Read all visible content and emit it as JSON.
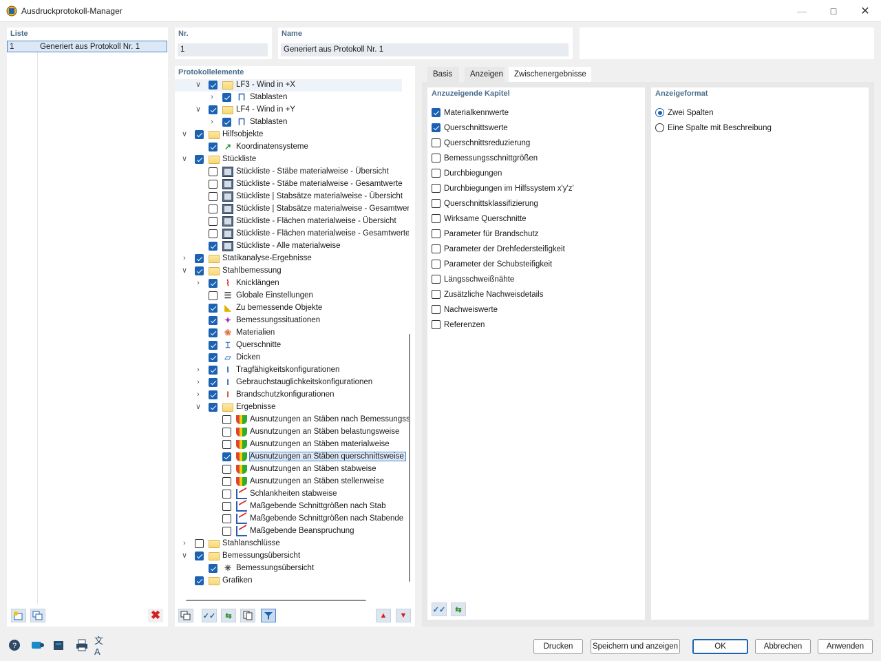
{
  "window": {
    "title": "Ausdruckprotokoll-Manager"
  },
  "list": {
    "label": "Liste",
    "rows": [
      {
        "num": "1",
        "name": "Generiert aus Protokoll Nr. 1"
      }
    ]
  },
  "header": {
    "nr_label": "Nr.",
    "nr_value": "1",
    "name_label": "Name",
    "name_value": "Generiert aus Protokoll Nr. 1"
  },
  "tree": {
    "label": "Protokollelemente",
    "items": [
      {
        "level": 1,
        "expander": "down",
        "checked": true,
        "icon": "folder-icon",
        "label": "LF3 - Wind in +X",
        "highlight": true
      },
      {
        "level": 2,
        "expander": "right",
        "checked": true,
        "icon": "member-load-icon",
        "label": "Stablasten"
      },
      {
        "level": 1,
        "expander": "down",
        "checked": true,
        "icon": "folder-icon",
        "label": "LF4 - Wind in +Y"
      },
      {
        "level": 2,
        "expander": "right",
        "checked": true,
        "icon": "member-load-icon",
        "label": "Stablasten"
      },
      {
        "level": 0,
        "expander": "down",
        "checked": true,
        "icon": "folder-icon",
        "label": "Hilfsobjekte"
      },
      {
        "level": 1,
        "expander": "",
        "checked": true,
        "icon": "coordinate-system-icon",
        "label": "Koordinatensysteme"
      },
      {
        "level": 0,
        "expander": "down",
        "checked": true,
        "icon": "folder-icon",
        "label": "Stückliste"
      },
      {
        "level": 1,
        "expander": "",
        "checked": false,
        "icon": "parts-list-icon",
        "label": "Stückliste - Stäbe materialweise - Übersicht"
      },
      {
        "level": 1,
        "expander": "",
        "checked": false,
        "icon": "parts-list-icon",
        "label": "Stückliste - Stäbe materialweise - Gesamtwerte"
      },
      {
        "level": 1,
        "expander": "",
        "checked": false,
        "icon": "parts-list-icon",
        "label": "Stückliste | Stabsätze materialweise - Übersicht"
      },
      {
        "level": 1,
        "expander": "",
        "checked": false,
        "icon": "parts-list-icon",
        "label": "Stückliste | Stabsätze materialweise - Gesamtwerte"
      },
      {
        "level": 1,
        "expander": "",
        "checked": false,
        "icon": "parts-list-icon",
        "label": "Stückliste - Flächen materialweise - Übersicht"
      },
      {
        "level": 1,
        "expander": "",
        "checked": false,
        "icon": "parts-list-icon",
        "label": "Stückliste - Flächen materialweise - Gesamtwerte"
      },
      {
        "level": 1,
        "expander": "",
        "checked": true,
        "icon": "parts-list-icon",
        "label": "Stückliste - Alle materialweise"
      },
      {
        "level": 0,
        "expander": "right",
        "checked": true,
        "icon": "folder-icon",
        "label": "Statikanalyse-Ergebnisse"
      },
      {
        "level": 0,
        "expander": "down",
        "checked": true,
        "icon": "folder-icon",
        "label": "Stahlbemessung"
      },
      {
        "level": 1,
        "expander": "right",
        "checked": true,
        "icon": "buckling-icon",
        "label": "Knicklängen"
      },
      {
        "level": 1,
        "expander": "",
        "checked": false,
        "icon": "settings-icon",
        "label": "Globale Einstellungen"
      },
      {
        "level": 1,
        "expander": "",
        "checked": true,
        "icon": "design-objects-icon",
        "label": "Zu bemessende Objekte"
      },
      {
        "level": 1,
        "expander": "",
        "checked": true,
        "icon": "design-situations-icon",
        "label": "Bemessungssituationen"
      },
      {
        "level": 1,
        "expander": "",
        "checked": true,
        "icon": "materials-icon",
        "label": "Materialien"
      },
      {
        "level": 1,
        "expander": "",
        "checked": true,
        "icon": "cross-section-icon",
        "label": "Querschnitte"
      },
      {
        "level": 1,
        "expander": "",
        "checked": true,
        "icon": "thickness-icon",
        "label": "Dicken"
      },
      {
        "level": 1,
        "expander": "right",
        "checked": true,
        "icon": "config-icon",
        "label": "Tragfähigkeitskonfigurationen"
      },
      {
        "level": 1,
        "expander": "right",
        "checked": true,
        "icon": "config-icon",
        "label": "Gebrauchstauglichkeitskonfigurationen"
      },
      {
        "level": 1,
        "expander": "right",
        "checked": true,
        "icon": "fire-config-icon",
        "label": "Brandschutzkonfigurationen"
      },
      {
        "level": 1,
        "expander": "down",
        "checked": true,
        "icon": "folder-icon",
        "label": "Ergebnisse"
      },
      {
        "level": 2,
        "expander": "",
        "checked": false,
        "icon": "ratio-bar-icon",
        "label": "Ausnutzungen an Stäben nach Bemessungssi"
      },
      {
        "level": 2,
        "expander": "",
        "checked": false,
        "icon": "ratio-bar-icon",
        "label": "Ausnutzungen an Stäben belastungsweise"
      },
      {
        "level": 2,
        "expander": "",
        "checked": false,
        "icon": "ratio-bar-icon",
        "label": "Ausnutzungen an Stäben materialweise"
      },
      {
        "level": 2,
        "expander": "",
        "checked": true,
        "icon": "ratio-bar-icon",
        "label": "Ausnutzungen an Stäben querschnittsweise",
        "selected": true
      },
      {
        "level": 2,
        "expander": "",
        "checked": false,
        "icon": "ratio-bar-icon",
        "label": "Ausnutzungen an Stäben stabweise"
      },
      {
        "level": 2,
        "expander": "",
        "checked": false,
        "icon": "ratio-bar-icon",
        "label": "Ausnutzungen an Stäben stellenweise"
      },
      {
        "level": 2,
        "expander": "",
        "checked": false,
        "icon": "graph-icon",
        "label": "Schlankheiten stabweise"
      },
      {
        "level": 2,
        "expander": "",
        "checked": false,
        "icon": "graph-icon",
        "label": "Maßgebende Schnittgrößen nach Stab"
      },
      {
        "level": 2,
        "expander": "",
        "checked": false,
        "icon": "graph-icon",
        "label": "Maßgebende Schnittgrößen nach Stabende"
      },
      {
        "level": 2,
        "expander": "",
        "checked": false,
        "icon": "graph-icon",
        "label": "Maßgebende Beanspruchung"
      },
      {
        "level": 0,
        "expander": "right",
        "checked": false,
        "icon": "folder-icon",
        "label": "Stahlanschlüsse"
      },
      {
        "level": 0,
        "expander": "down",
        "checked": true,
        "icon": "folder-icon",
        "label": "Bemessungsübersicht"
      },
      {
        "level": 1,
        "expander": "",
        "checked": true,
        "icon": "summary-icon",
        "label": "Bemessungsübersicht"
      },
      {
        "level": 0,
        "expander": "",
        "checked": true,
        "icon": "folder-icon",
        "label": "Grafiken"
      }
    ]
  },
  "tabs": [
    {
      "label": "Basis",
      "active": false
    },
    {
      "label": "Anzeigen",
      "active": false
    },
    {
      "label": "Zwischenergebnisse",
      "active": true
    }
  ],
  "chapters": {
    "label": "Anzuzeigende Kapitel",
    "items": [
      {
        "label": "Materialkennwerte",
        "checked": true
      },
      {
        "label": "Querschnittswerte",
        "checked": true
      },
      {
        "label": "Querschnittsreduzierung",
        "checked": false
      },
      {
        "label": "Bemessungsschnittgrößen",
        "checked": false
      },
      {
        "label": "Durchbiegungen",
        "checked": false
      },
      {
        "label": "Durchbiegungen im Hilfssystem x'y'z'",
        "checked": false
      },
      {
        "label": "Querschnittsklassifizierung",
        "checked": false
      },
      {
        "label": "Wirksame Querschnitte",
        "checked": false
      },
      {
        "label": "Parameter für Brandschutz",
        "checked": false
      },
      {
        "label": "Parameter der Drehfedersteifigkeit",
        "checked": false
      },
      {
        "label": "Parameter der Schubsteifigkeit",
        "checked": false
      },
      {
        "label": "Längsschweißnähte",
        "checked": false
      },
      {
        "label": "Zusätzliche Nachweisdetails",
        "checked": false
      },
      {
        "label": "Nachweiswerte",
        "checked": false
      },
      {
        "label": "Referenzen",
        "checked": false
      }
    ]
  },
  "format": {
    "label": "Anzeigeformat",
    "options": [
      {
        "label": "Zwei Spalten",
        "selected": true
      },
      {
        "label": "Eine Spalte mit Beschreibung",
        "selected": false
      }
    ]
  },
  "buttons": {
    "print": "Drucken",
    "save_show": "Speichern und anzeigen",
    "ok": "OK",
    "cancel": "Abbrechen",
    "apply": "Anwenden"
  },
  "colors": {
    "accent": "#1b62b3",
    "label": "#4a6d8c",
    "delete": "#d62020"
  }
}
